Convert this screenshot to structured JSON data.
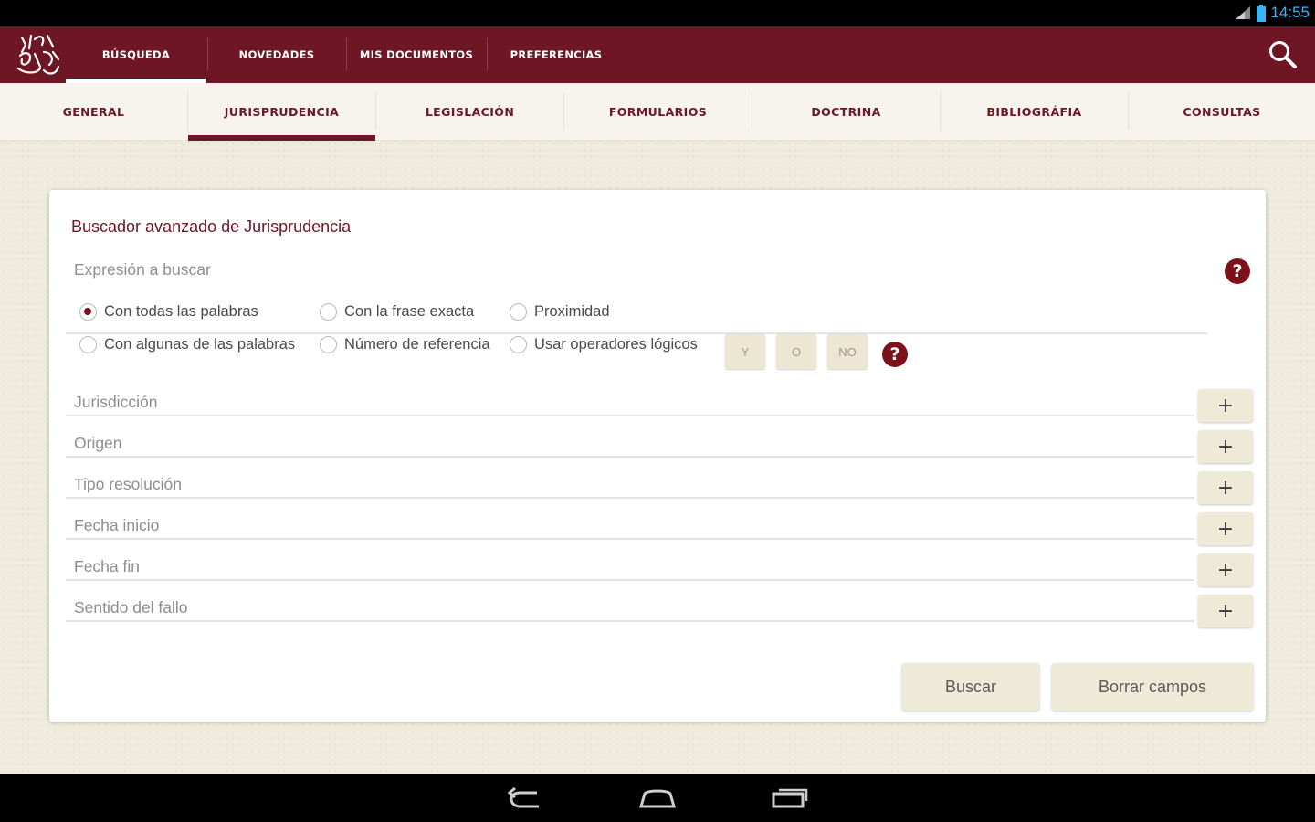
{
  "status": {
    "time": "14:55",
    "icons": [
      "signal-icon",
      "battery-icon"
    ]
  },
  "appbar": {
    "logo": "app-logo",
    "tabs": [
      {
        "label": "BÚSQUEDA",
        "active": true
      },
      {
        "label": "NOVEDADES",
        "active": false
      },
      {
        "label": "MIS DOCUMENTOS",
        "active": false
      },
      {
        "label": "PREFERENCIAS",
        "active": false
      }
    ],
    "search_icon": "search-icon"
  },
  "subtabs": [
    {
      "label": "GENERAL",
      "active": false
    },
    {
      "label": "JURISPRUDENCIA",
      "active": true
    },
    {
      "label": "LEGISLACIÓN",
      "active": false
    },
    {
      "label": "FORMULARIOS",
      "active": false
    },
    {
      "label": "DOCTRINA",
      "active": false
    },
    {
      "label": "BIBLIOGRÁFIA",
      "active": false
    },
    {
      "label": "CONSULTAS",
      "active": false
    }
  ],
  "form": {
    "title": "Buscador avanzado de Jurisprudencia",
    "expression_placeholder": "Expresión a buscar",
    "search_mode": {
      "options": [
        {
          "label": "Con todas las palabras",
          "checked": true
        },
        {
          "label": "Con la frase exacta",
          "checked": false
        },
        {
          "label": "Proximidad",
          "checked": false
        },
        {
          "label": "Con algunas de las palabras",
          "checked": false
        },
        {
          "label": "Número de referencia",
          "checked": false
        },
        {
          "label": "Usar operadores lógicos",
          "checked": false
        }
      ]
    },
    "operators": [
      "Y",
      "O",
      "NO"
    ],
    "filters": [
      {
        "label": "Jurisdicción"
      },
      {
        "label": "Origen"
      },
      {
        "label": "Tipo resolución"
      },
      {
        "label": "Fecha inicio"
      },
      {
        "label": "Fecha fin"
      },
      {
        "label": "Sentido del fallo"
      }
    ],
    "add_symbol": "+",
    "help_symbol": "?",
    "buttons": {
      "search": "Buscar",
      "clear": "Borrar campos"
    }
  },
  "colors": {
    "brand": "#6e1624",
    "help": "#7c1119",
    "status_time": "#3ab4f2",
    "button_bg": "#efe9d8"
  }
}
